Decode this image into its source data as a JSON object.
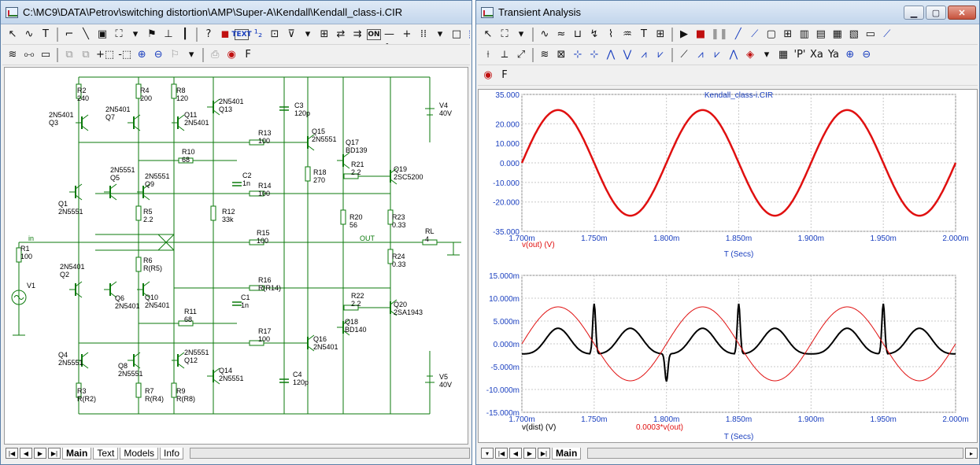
{
  "schematic_window": {
    "title": "C:\\MC9\\DATA\\Petrov\\switching distortion\\AMP\\Super-A\\Kendall\\Kendall_class-i.CIR",
    "tabs": [
      "Main",
      "Text",
      "Models",
      "Info"
    ],
    "active_tab": "Main",
    "toolbar1": [
      {
        "name": "select-arrow-icon",
        "glyph": "↖"
      },
      {
        "name": "wire-wavy-icon",
        "glyph": "∿"
      },
      {
        "name": "text-tool-icon",
        "glyph": "T"
      },
      {
        "name": "ortho-wire-icon",
        "glyph": "⌐"
      },
      {
        "name": "diagonal-wire-icon",
        "glyph": "╲"
      },
      {
        "name": "bus-icon",
        "glyph": "▣"
      },
      {
        "name": "component-icon",
        "glyph": "⛶"
      },
      {
        "name": "dropdown-arrow-icon",
        "glyph": "▾"
      },
      {
        "name": "flag-icon",
        "glyph": "⚑"
      },
      {
        "name": "pin-icon",
        "glyph": "⊥"
      },
      {
        "name": "info-icon",
        "glyph": "┃"
      },
      {
        "name": "help-icon",
        "glyph": "?"
      },
      {
        "name": "probe-icon",
        "glyph": "◼"
      },
      {
        "name": "text-button-icon",
        "glyph": "TEXT"
      },
      {
        "name": "node-numbers-icon",
        "glyph": "¹₂"
      },
      {
        "name": "pin-connect-icon",
        "glyph": "⊡"
      },
      {
        "name": "voltage-icon",
        "glyph": "⊽"
      },
      {
        "name": "dropdown-arrow2-icon",
        "glyph": "▾"
      },
      {
        "name": "attribute-icon",
        "glyph": "⊞"
      },
      {
        "name": "swap-arrows-icon",
        "glyph": "⇄"
      },
      {
        "name": "stepping-icon",
        "glyph": "⇉"
      },
      {
        "name": "on-off-icon",
        "glyph": "ON"
      },
      {
        "name": "pin-dot-icon",
        "glyph": "•—•"
      },
      {
        "name": "cross-icon",
        "glyph": "+"
      },
      {
        "name": "grid-dots-icon",
        "glyph": "⁞⁞"
      },
      {
        "name": "dropdown-arrow3-icon",
        "glyph": "▾"
      },
      {
        "name": "rectangle-icon",
        "glyph": "□"
      },
      {
        "name": "zoom-box-icon",
        "glyph": "⬚"
      }
    ],
    "toolbar2": [
      {
        "name": "analog-icon",
        "glyph": "≋"
      },
      {
        "name": "find-binoculars-icon",
        "glyph": "⧟"
      },
      {
        "name": "comment-icon",
        "glyph": "▭"
      },
      {
        "name": "copy-disabled-icon",
        "glyph": "⧉"
      },
      {
        "name": "paste-disabled-icon",
        "glyph": "⧉"
      },
      {
        "name": "add-page-icon",
        "glyph": "+⬚"
      },
      {
        "name": "remove-page-icon",
        "glyph": "-⬚"
      },
      {
        "name": "zoom-in-icon",
        "glyph": "⊕"
      },
      {
        "name": "zoom-out-icon",
        "glyph": "⊖"
      },
      {
        "name": "flag-disabled-icon",
        "glyph": "⚐"
      },
      {
        "name": "dropdown-arrow4-icon",
        "glyph": "▾"
      },
      {
        "name": "print-disabled-icon",
        "glyph": "⎙"
      },
      {
        "name": "palette-icon",
        "glyph": "◉"
      },
      {
        "name": "font-icon",
        "glyph": "F"
      }
    ],
    "components": [
      {
        "t": "R2",
        "v": "240"
      },
      {
        "t": "R4",
        "v": "200"
      },
      {
        "t": "R8",
        "v": "120"
      },
      {
        "t": "2N5401",
        "v": "Q13"
      },
      {
        "t": "2N5401",
        "v": "Q3"
      },
      {
        "t": "2N5401",
        "v": "Q7"
      },
      {
        "t": "Q11",
        "v": "2N5401"
      },
      {
        "t": "C3",
        "v": "120p"
      },
      {
        "t": "V4",
        "v": "40V"
      },
      {
        "t": "R13",
        "v": "100"
      },
      {
        "t": "Q15",
        "v": "2N5551"
      },
      {
        "t": "Q17",
        "v": "BD139"
      },
      {
        "t": "R10",
        "v": "68"
      },
      {
        "t": "2N5551",
        "v": "Q5"
      },
      {
        "t": "2N5551",
        "v": "Q9"
      },
      {
        "t": "C2",
        "v": "1n"
      },
      {
        "t": "R14",
        "v": "100"
      },
      {
        "t": "R18",
        "v": "270"
      },
      {
        "t": "R21",
        "v": "2.2"
      },
      {
        "t": "Q19",
        "v": "2SC5200"
      },
      {
        "t": "Q1",
        "v": "2N5551"
      },
      {
        "t": "R5",
        "v": "2.2"
      },
      {
        "t": "R12",
        "v": "33k"
      },
      {
        "t": "R20",
        "v": "56"
      },
      {
        "t": "R23",
        "v": "0.33"
      },
      {
        "t": "R1",
        "v": "100"
      },
      {
        "t": "R15",
        "v": "100"
      },
      {
        "t": "RL",
        "v": "4"
      },
      {
        "t": "R6",
        "v": "R(R5)"
      },
      {
        "t": "R24",
        "v": "0.33"
      },
      {
        "t": "2N5401",
        "v": "Q2"
      },
      {
        "t": "V1",
        "v": ""
      },
      {
        "t": "Q6",
        "v": "2N5401"
      },
      {
        "t": "Q10",
        "v": "2N5401"
      },
      {
        "t": "R16",
        "v": "R(R14)"
      },
      {
        "t": "C1",
        "v": "1n"
      },
      {
        "t": "R22",
        "v": "2.2"
      },
      {
        "t": "Q20",
        "v": "2SA1943"
      },
      {
        "t": "R11",
        "v": "68"
      },
      {
        "t": "Q18",
        "v": "BD140"
      },
      {
        "t": "R17",
        "v": "100"
      },
      {
        "t": "Q16",
        "v": "2N5401"
      },
      {
        "t": "Q4",
        "v": "2N5551"
      },
      {
        "t": "Q8",
        "v": "2N5551"
      },
      {
        "t": "2N5551",
        "v": "Q12"
      },
      {
        "t": "Q14",
        "v": "2N5551"
      },
      {
        "t": "C4",
        "v": "120p"
      },
      {
        "t": "V5",
        "v": "40V"
      },
      {
        "t": "R3",
        "v": "R(R2)"
      },
      {
        "t": "R7",
        "v": "R(R4)"
      },
      {
        "t": "R9",
        "v": "R(R8)"
      }
    ],
    "node_labels": {
      "in": "in",
      "out": "OUT"
    }
  },
  "transient_window": {
    "title": "Transient Analysis",
    "tab": "Main",
    "toolbar1": [
      {
        "name": "select-arrow-icon",
        "glyph": "↖"
      },
      {
        "name": "component-icon",
        "glyph": "⛶"
      },
      {
        "name": "dropdown-arrow-icon",
        "glyph": "▾"
      },
      {
        "name": "wave1-icon",
        "glyph": "∿"
      },
      {
        "name": "wave2-icon",
        "glyph": "≈"
      },
      {
        "name": "wave3-icon",
        "glyph": "⊔"
      },
      {
        "name": "wave4-icon",
        "glyph": "↯"
      },
      {
        "name": "wave5-icon",
        "glyph": "⌇"
      },
      {
        "name": "wave6-icon",
        "glyph": "♒"
      },
      {
        "name": "text-tool-icon",
        "glyph": "T"
      },
      {
        "name": "properties-icon",
        "glyph": "⊞"
      },
      {
        "name": "run-icon",
        "glyph": "▶"
      },
      {
        "name": "stop-disabled-icon",
        "glyph": "■"
      },
      {
        "name": "pause-disabled-icon",
        "glyph": "❚❚"
      },
      {
        "name": "line-icon",
        "glyph": "╱"
      },
      {
        "name": "polyline-icon",
        "glyph": "⟋"
      },
      {
        "name": "box-icon",
        "glyph": "▢"
      },
      {
        "name": "grid-icon",
        "glyph": "⊞"
      },
      {
        "name": "bars1-icon",
        "glyph": "▥"
      },
      {
        "name": "bars2-icon",
        "glyph": "▤"
      },
      {
        "name": "bars3-icon",
        "glyph": "▦"
      },
      {
        "name": "bars4-icon",
        "glyph": "▧"
      },
      {
        "name": "bars5-icon",
        "glyph": "▭"
      },
      {
        "name": "scope-icon",
        "glyph": "⟋"
      }
    ],
    "toolbar2": [
      {
        "name": "tool-a-icon",
        "glyph": "⟊"
      },
      {
        "name": "tool-b-icon",
        "glyph": "⟂"
      },
      {
        "name": "tool-c-icon",
        "glyph": "⤢"
      },
      {
        "name": "tool-d-icon",
        "glyph": "≋"
      },
      {
        "name": "tool-e-icon",
        "glyph": "⊠"
      },
      {
        "name": "cursor1-icon",
        "glyph": "⊹"
      },
      {
        "name": "cursor2-icon",
        "glyph": "⊹"
      },
      {
        "name": "peak-icon",
        "glyph": "⋀"
      },
      {
        "name": "valley-icon",
        "glyph": "⋁"
      },
      {
        "name": "peak2-icon",
        "glyph": "⩘"
      },
      {
        "name": "valley2-icon",
        "glyph": "⩗"
      },
      {
        "name": "slope-icon",
        "glyph": "⟋"
      },
      {
        "name": "peak3-icon",
        "glyph": "⩘"
      },
      {
        "name": "valley3-icon",
        "glyph": "⩗"
      },
      {
        "name": "peak4-icon",
        "glyph": "⋀"
      },
      {
        "name": "palette2-icon",
        "glyph": "◈"
      },
      {
        "name": "dropdown-arrow2-icon",
        "glyph": "▾"
      },
      {
        "name": "table-icon",
        "glyph": "▦"
      },
      {
        "name": "p-icon",
        "glyph": "'P'"
      },
      {
        "name": "xa-icon",
        "glyph": "Xa"
      },
      {
        "name": "ya-icon",
        "glyph": "Ya"
      },
      {
        "name": "zoom-in-icon",
        "glyph": "⊕"
      },
      {
        "name": "zoom-out-icon",
        "glyph": "⊖"
      }
    ],
    "toolbar3": [
      {
        "name": "palette-icon",
        "glyph": "◉"
      },
      {
        "name": "font-icon",
        "glyph": "F"
      }
    ],
    "plot1": {
      "title": "Kendall_class-i.CIR",
      "trace_label": "v(out) (V)",
      "xlabel": "T (Secs)",
      "yticks": [
        "35.000",
        "20.000",
        "10.000",
        "0.000",
        "-10.000",
        "-20.000",
        "-35.000"
      ],
      "xticks": [
        "1.700m",
        "1.750m",
        "1.800m",
        "1.850m",
        "1.900m",
        "1.950m",
        "2.000m"
      ]
    },
    "plot2": {
      "trace_label1": "v(dist) (V)",
      "trace_label2": "0.0003*v(out)",
      "xlabel": "T (Secs)",
      "yticks": [
        "15.000m",
        "10.000m",
        "5.000m",
        "0.000m",
        "-5.000m",
        "-10.000m",
        "-15.000m"
      ],
      "xticks": [
        "1.700m",
        "1.750m",
        "1.800m",
        "1.850m",
        "1.900m",
        "1.950m",
        "2.000m"
      ]
    }
  },
  "chart_data": [
    {
      "type": "line",
      "title": "Kendall_class-i.CIR",
      "xlabel": "T (Secs)",
      "ylabel": "v(out) (V)",
      "xlim": [
        0.0017,
        0.002
      ],
      "ylim": [
        -35,
        35
      ],
      "series": [
        {
          "name": "v(out) (V)",
          "color": "#e01010",
          "shape": "sine",
          "amplitude": 27,
          "frequency_hz": 10000,
          "phase_peak_t": 0.001725
        }
      ]
    },
    {
      "type": "line",
      "xlabel": "T (Secs)",
      "ylabel": "v(dist) (V)",
      "xlim": [
        0.0017,
        0.002
      ],
      "ylim": [
        -0.015,
        0.015
      ],
      "series": [
        {
          "name": "v(dist) (V)",
          "color": "#000000",
          "shape": "distortion",
          "spike_t": [
            0.00175,
            0.0018,
            0.00185,
            0.00195
          ],
          "spike_amplitude": 0.011
        },
        {
          "name": "0.0003*v(out)",
          "color": "#e01010",
          "shape": "sine",
          "amplitude": 0.0081,
          "frequency_hz": 10000,
          "phase_peak_t": 0.001725
        }
      ]
    }
  ]
}
